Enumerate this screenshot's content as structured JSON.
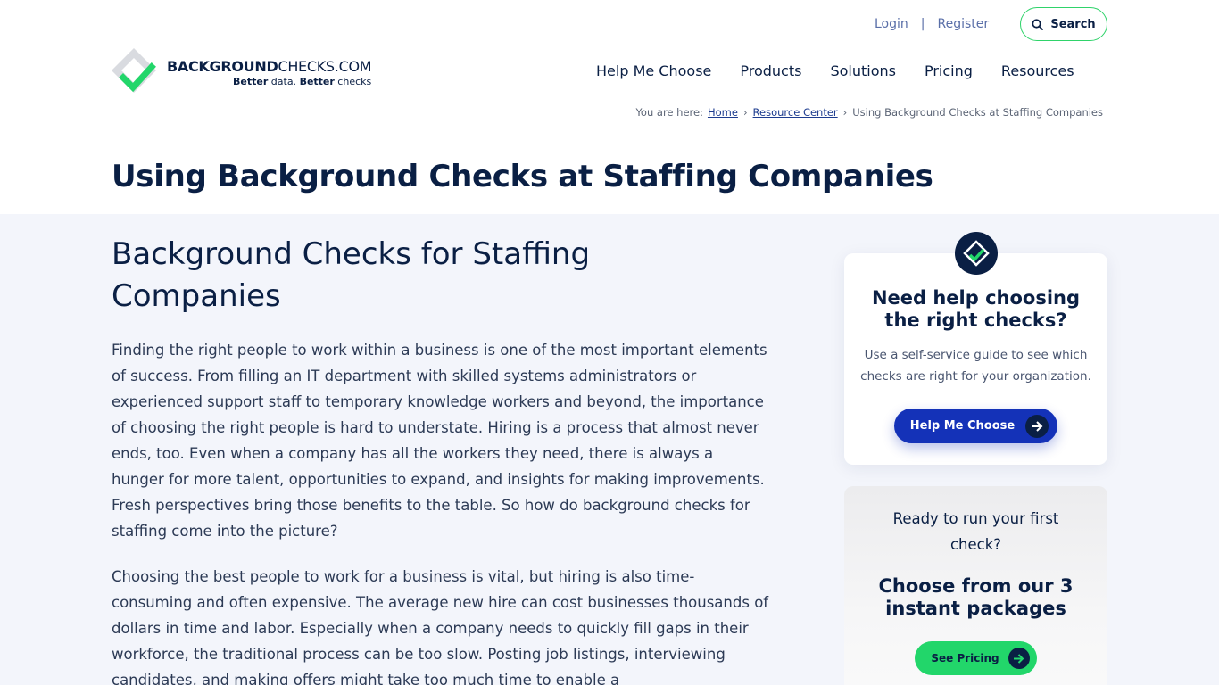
{
  "header": {
    "login": "Login",
    "register": "Register",
    "search": "Search",
    "logo": {
      "brand_bold": "BACKGROUND",
      "brand_rest": "CHECKS.COM",
      "tag_bold1": "Better",
      "tag_rest1": " data. ",
      "tag_bold2": "Better",
      "tag_rest2": " checks"
    }
  },
  "nav": [
    "Help Me Choose",
    "Products",
    "Solutions",
    "Pricing",
    "Resources"
  ],
  "breadcrumb": {
    "prefix": "You are here:",
    "home": "Home",
    "resource_center": "Resource Center",
    "current": "Using Background Checks at Staffing Companies"
  },
  "page_title": "Using Background Checks at Staffing Companies",
  "article": {
    "heading": "Background Checks for Staffing Companies",
    "paragraphs": [
      "Finding the right people to work within a business is one of the most important elements of success. From filling an IT department with skilled systems administrators or experienced support staff to temporary knowledge workers and beyond, the importance of choosing the right people is hard to understate. Hiring is a process that almost never ends, too. Even when a company has all the workers they need, there is always a hunger for more talent, opportunities to expand, and insights for making improvements. Fresh perspectives bring those benefits to the table. So how do background checks for staffing come into the picture?",
      "Choosing the best people to work for a business is vital, but hiring is also time-consuming and often expensive. The average new hire can cost businesses thousands of dollars in time and labor. Especially when a company needs to quickly fill gaps in their workforce, the traditional process can be too slow. Posting job listings, interviewing candidates, and making offers might take too much time to enable a"
    ]
  },
  "sidebar": {
    "help_card": {
      "title": "Need help choosing the right checks?",
      "text": "Use a self-service guide to see which checks are right for your organization.",
      "button": "Help Me Choose"
    },
    "pricing_card": {
      "ready": "Ready to run your first check?",
      "title": "Choose from our 3 instant packages",
      "button": "See Pricing"
    }
  },
  "colors": {
    "navy": "#0a1f44",
    "accent_green": "#22d66a",
    "button_blue": "#1432b8",
    "band_bg": "#f3f5fb"
  }
}
